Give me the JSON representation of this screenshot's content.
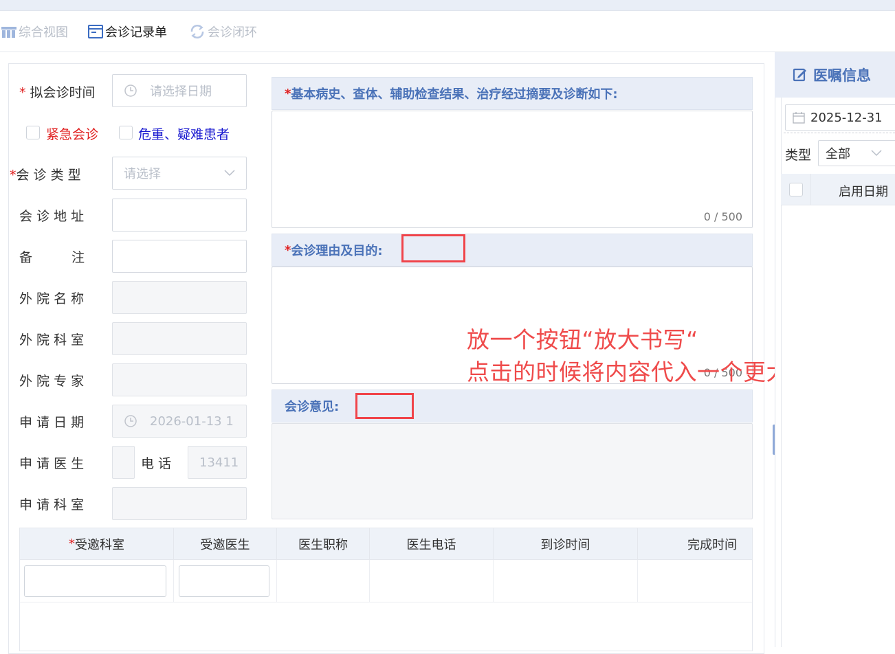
{
  "toolbar": {
    "overview_label": "综合视图",
    "record_label": "会诊记录单",
    "closed_loop_label": "会诊闭环"
  },
  "form": {
    "planned_time": {
      "label": "拟会诊时间",
      "placeholder": "请选择日期"
    },
    "urgent_label": "紧急会诊",
    "critical_label": "危重、疑难患者",
    "consult_type": {
      "label": "会 诊 类 型",
      "placeholder": "请选择"
    },
    "address_label": "会 诊 地 址",
    "remark_label": "备　　　注",
    "outer_hospital_label": "外 院 名 称",
    "outer_dept_label": "外 院 科 室",
    "outer_expert_label": "外 院 专 家",
    "apply_date": {
      "label": "申 请 日 期",
      "value": "2026-01-13 1"
    },
    "apply_doctor_label": "申 请 医 生",
    "phone": {
      "label": "电 话",
      "value": "13411"
    },
    "apply_dept_label": "申 请 科 室"
  },
  "sections": {
    "history": {
      "title": "基本病史、查体、辅助检查结果、治疗经过摘要及诊断如下:",
      "counter": "0 / 500"
    },
    "reason": {
      "title": "会诊理由及目的:",
      "counter": "0 / 500"
    },
    "opinion": {
      "title": "会诊意见:"
    }
  },
  "annotation": {
    "line1": "放一个按钮“放大书写“",
    "line2": "点击的时候将内容代入一个更大的界面"
  },
  "table": {
    "headers": [
      "受邀科室",
      "受邀医生",
      "医生职称",
      "医生电话",
      "到诊时间",
      "完成时间"
    ]
  },
  "right_panel": {
    "title": "医嘱信息",
    "date": "2025-12-31",
    "type_label": "类型",
    "type_value": "全部",
    "column_header": "启用日期"
  },
  "colors": {
    "accent": "#4a72b8",
    "required": "#e02020",
    "critical_text": "#1a1ad0",
    "annotation": "#ef4b4b"
  }
}
